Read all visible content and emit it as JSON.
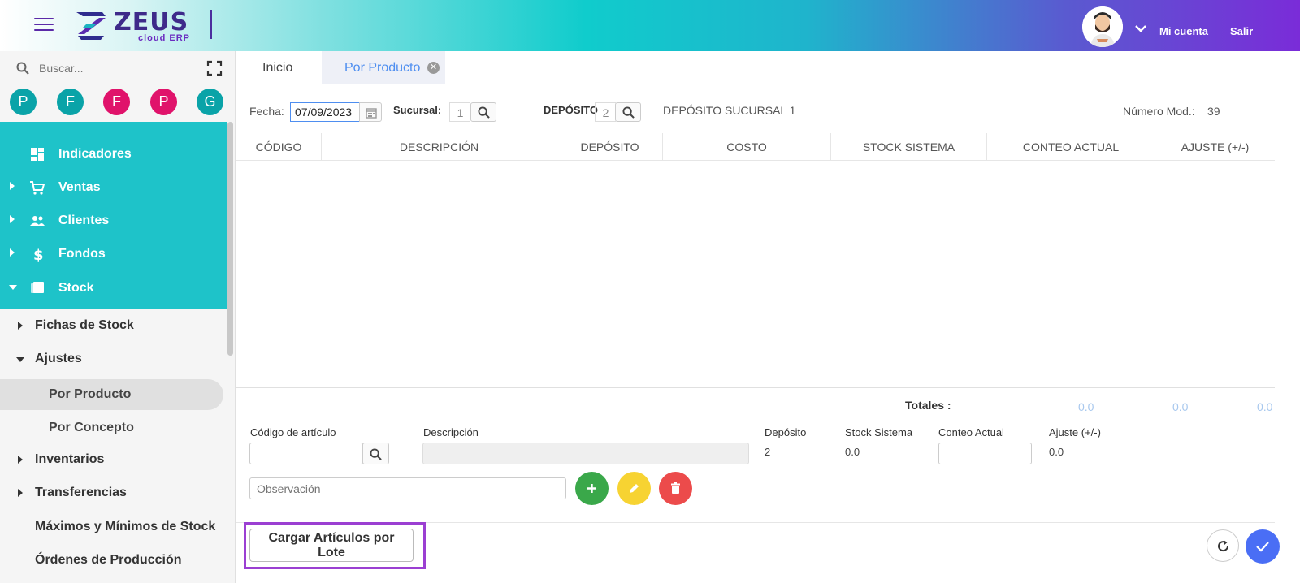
{
  "header": {
    "logo_text": "ZEUS",
    "logo_sub": "cloud ERP",
    "account_label": "Mi cuenta",
    "logout_label": "Salir"
  },
  "sidebar": {
    "search_placeholder": "Buscar...",
    "quick_buttons": [
      {
        "letter": "P",
        "color": "#0aa3a8"
      },
      {
        "letter": "F",
        "color": "#0aa3a8"
      },
      {
        "letter": "F",
        "color": "#e0136b"
      },
      {
        "letter": "P",
        "color": "#e0136b"
      },
      {
        "letter": "G",
        "color": "#0aa3a8"
      }
    ],
    "menu": [
      {
        "label": "Indicadores",
        "icon": "dashboard-icon"
      },
      {
        "label": "Ventas",
        "icon": "cart-icon"
      },
      {
        "label": "Clientes",
        "icon": "people-icon"
      },
      {
        "label": "Fondos",
        "icon": "dollar-icon"
      },
      {
        "label": "Stock",
        "icon": "stock-icon"
      }
    ],
    "stock_sub": [
      {
        "label": "Fichas de Stock"
      },
      {
        "label": "Ajustes"
      },
      {
        "label": "Por Producto"
      },
      {
        "label": "Por Concepto"
      },
      {
        "label": "Inventarios"
      },
      {
        "label": "Transferencias"
      },
      {
        "label": "Máximos y Mínimos de Stock"
      },
      {
        "label": "Órdenes de Producción"
      }
    ]
  },
  "tabs": [
    {
      "label": "Inicio"
    },
    {
      "label": "Por Producto",
      "active": true
    }
  ],
  "filters": {
    "fecha_label": "Fecha:",
    "fecha_value": "07/09/2023",
    "sucursal_label": "Sucursal:",
    "sucursal_value": "1",
    "deposito_label": "DEPÓSITO",
    "deposito_value": "2",
    "deposito_name": "DEPÓSITO SUCURSAL 1",
    "numero_label": "Número Mod.:",
    "numero_value": "39"
  },
  "table": {
    "columns": [
      "CÓDIGO",
      "DESCRIPCIÓN",
      "DEPÓSITO",
      "COSTO",
      "STOCK SISTEMA",
      "CONTEO ACTUAL",
      "AJUSTE (+/-)"
    ]
  },
  "totals": {
    "label": "Totales :",
    "values": [
      "0.0",
      "0.0",
      "0.0"
    ]
  },
  "form": {
    "codigo_label": "Código de artículo",
    "descripcion_label": "Descripción",
    "deposito_label": "Depósito",
    "deposito_value": "2",
    "stock_label": "Stock Sistema",
    "stock_value": "0.0",
    "conteo_label": "Conteo Actual",
    "ajuste_label": "Ajuste (+/-)",
    "ajuste_value": "0.0",
    "observacion_placeholder": "Observación"
  },
  "footer": {
    "lote_button": "Cargar Artículos por Lote"
  },
  "colors": {
    "teal": "#1ec3c9",
    "add": "#3aa84a",
    "edit": "#f7d332",
    "delete": "#ec4b4b",
    "confirm": "#4a6ef5",
    "active_tab": "#4e8ef0"
  }
}
